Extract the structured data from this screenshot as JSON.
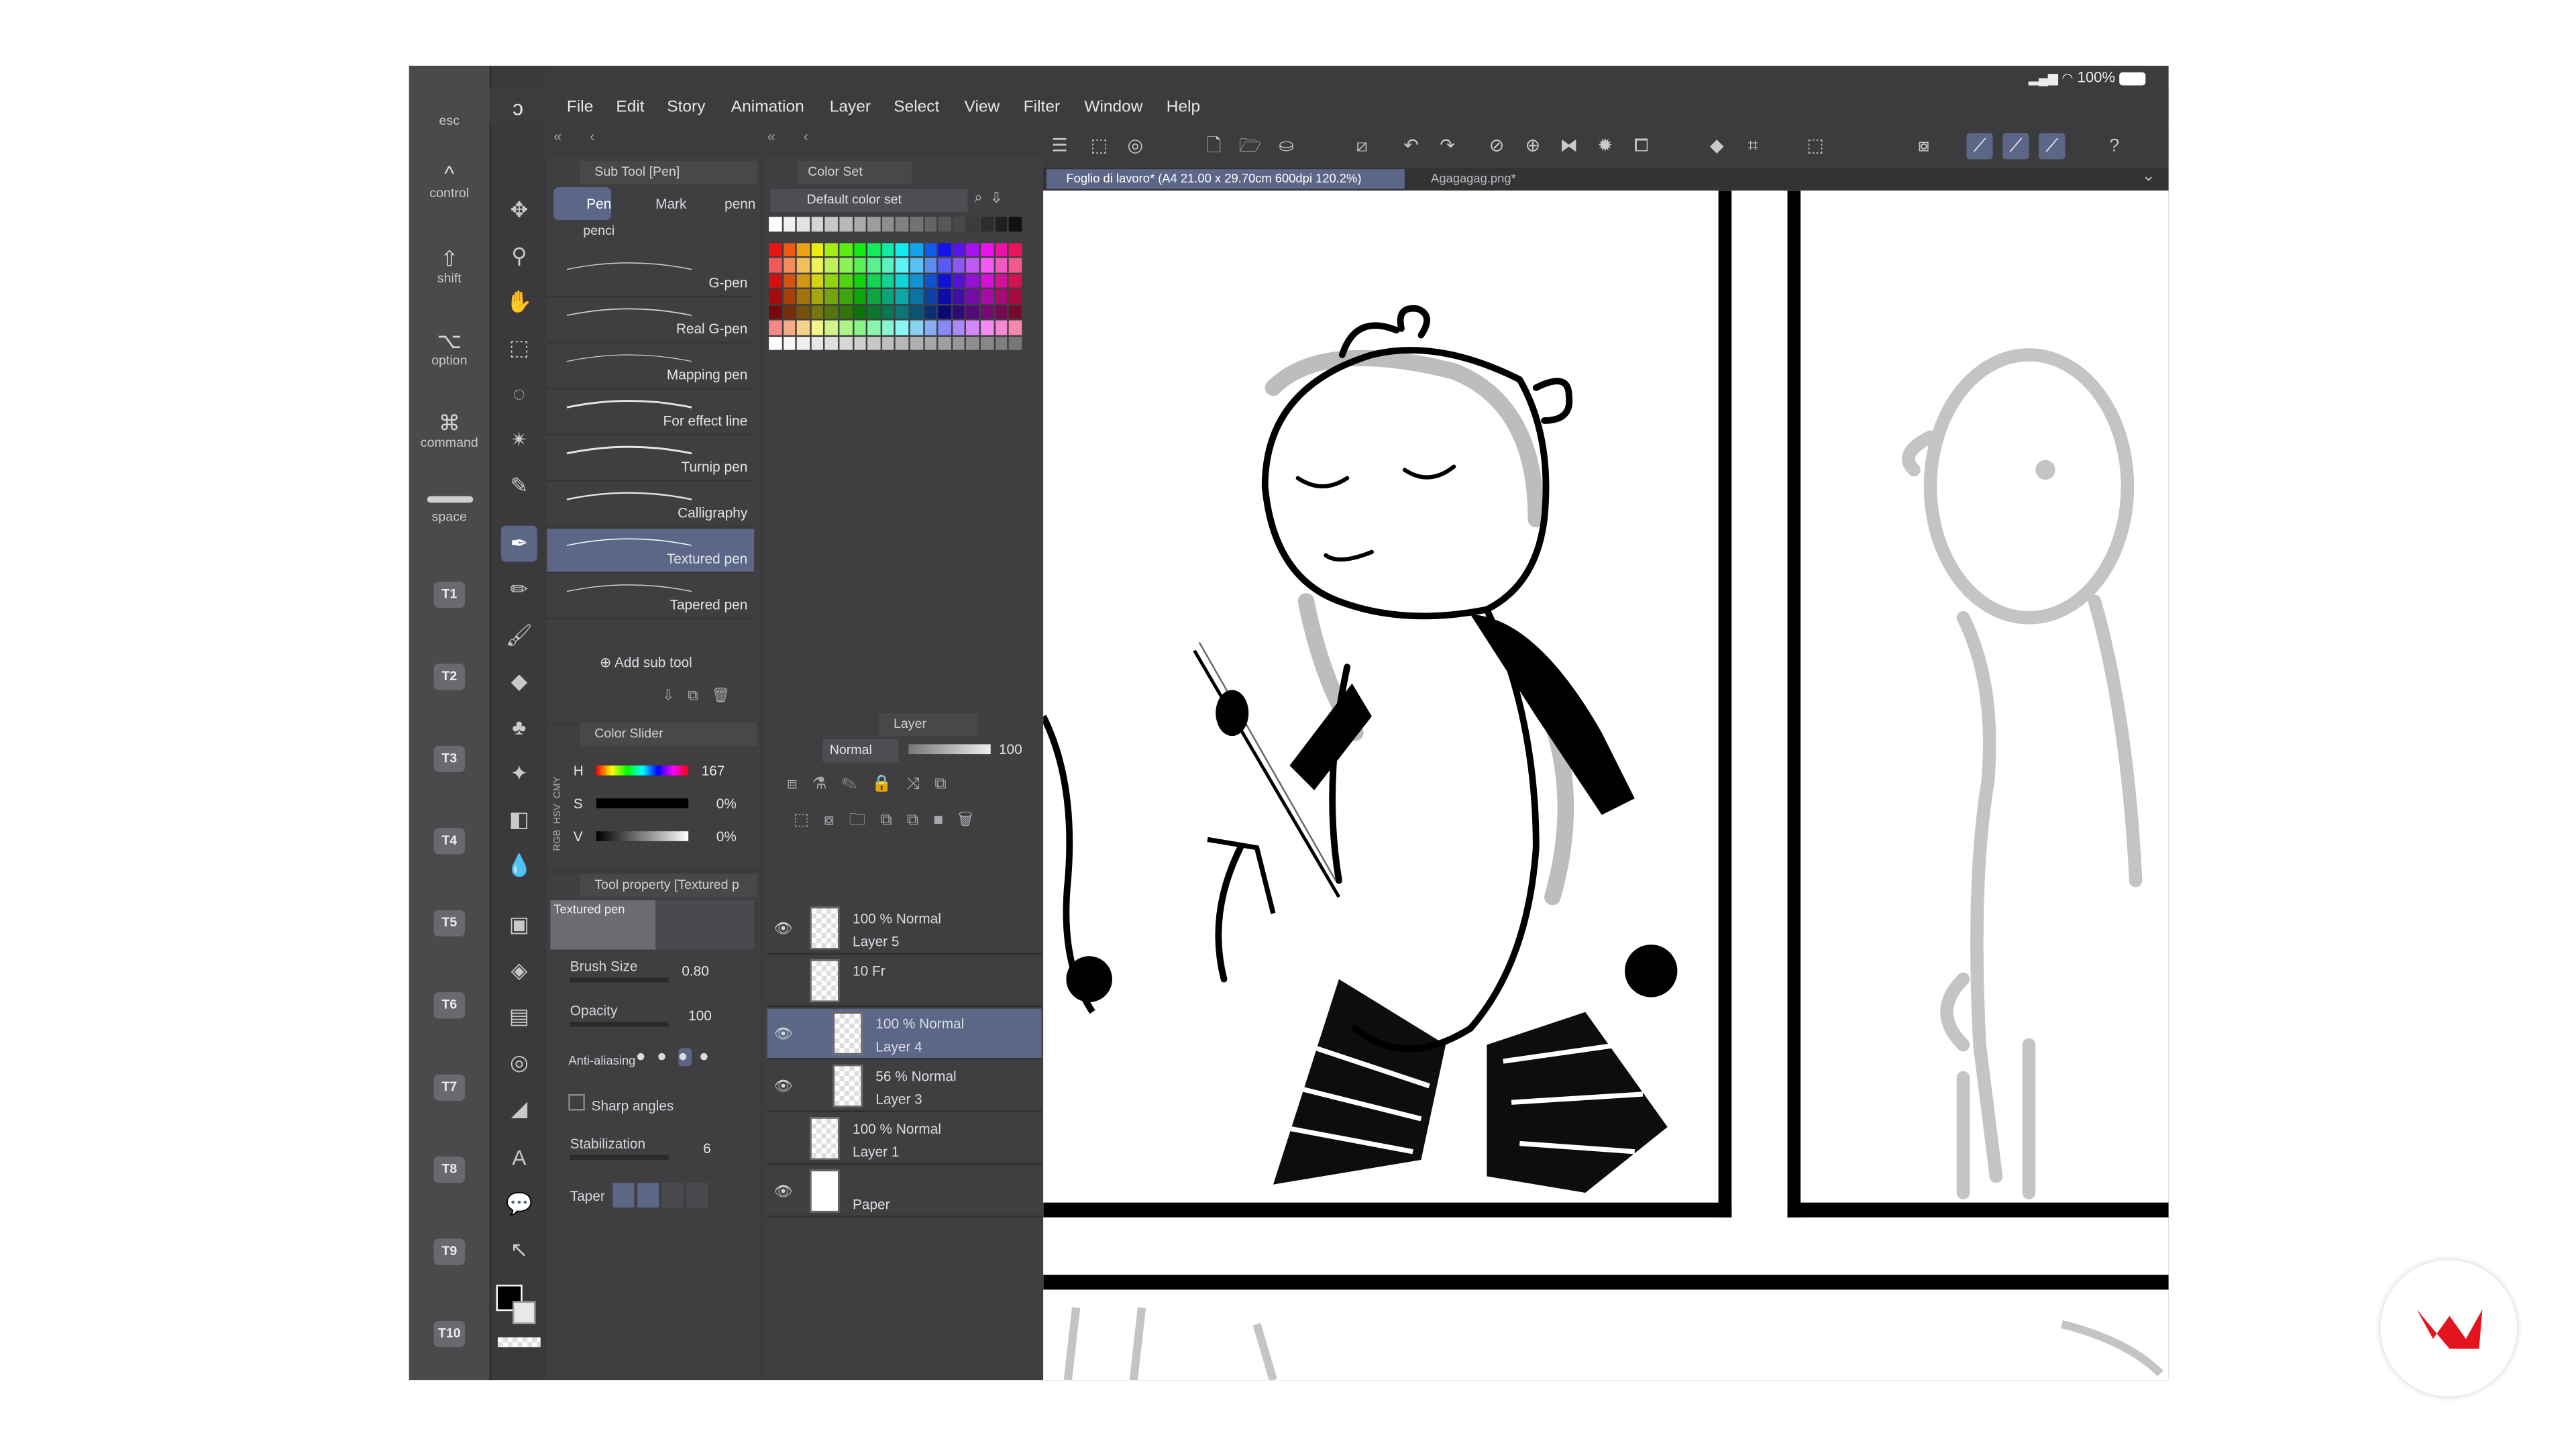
{
  "modifiers": {
    "esc": "esc",
    "control": "control",
    "shift": "shift",
    "option": "option",
    "command": "command",
    "space": "space",
    "control_glyph": "^",
    "shift_glyph": "⇧",
    "option_glyph": "⌥",
    "command_glyph": "⌘"
  },
  "tool_keys": [
    "T1",
    "T2",
    "T3",
    "T4",
    "T5",
    "T6",
    "T7",
    "T8",
    "T9",
    "T10"
  ],
  "menu": {
    "items": [
      "File",
      "Edit",
      "Story",
      "Animation",
      "Layer",
      "Select",
      "View",
      "Filter",
      "Window",
      "Help"
    ]
  },
  "status": {
    "battery": "100%"
  },
  "sub_tool": {
    "title": "Sub Tool [Pen]",
    "tabs": [
      "Pen",
      "Mark",
      "penn"
    ],
    "group": "penci",
    "items": [
      "G-pen",
      "Real G-pen",
      "Mapping pen",
      "For effect line",
      "Turnip pen",
      "Calligraphy",
      "Textured pen",
      "Tapered pen"
    ],
    "selected": "Textured pen",
    "add_label": "Add sub tool"
  },
  "color_set": {
    "title": "Color Set",
    "set_name": "Default color set"
  },
  "color_slider": {
    "title": "Color Slider",
    "h_label": "H",
    "s_label": "S",
    "v_label": "V",
    "h_value": "167",
    "s_value": "0%",
    "v_value": "0%",
    "modes": [
      "RGB",
      "HSV",
      "CMY"
    ]
  },
  "tool_property": {
    "title": "Tool property [Textured p",
    "preview_label": "Textured pen",
    "brush_size_label": "Brush Size",
    "brush_size_value": "0.80",
    "opacity_label": "Opacity",
    "opacity_value": "100",
    "aa_label": "Anti-aliasing",
    "sharp_label": "Sharp angles",
    "stab_label": "Stabilization",
    "stab_value": "6",
    "taper_label": "Taper"
  },
  "layer_panel": {
    "title": "Layer",
    "blend": "Normal",
    "opacity": "100",
    "layers": [
      {
        "pct": "100 %",
        "mode": "Normal",
        "name": "Layer 5"
      },
      {
        "pct": "10",
        "mode": "Fr",
        "name": ""
      },
      {
        "pct": "100 %",
        "mode": "Normal",
        "name": "Layer 4"
      },
      {
        "pct": "56 %",
        "mode": "Normal",
        "name": "Layer 3"
      },
      {
        "pct": "100 %",
        "mode": "Normal",
        "name": "Layer 1"
      },
      {
        "pct": "",
        "mode": "",
        "name": "Paper"
      }
    ]
  },
  "doc_tabs": {
    "active": "Foglio di lavoro* (A4 21.00 x 29.70cm 600dpi 120.2%)",
    "other": "Agagagag.png*"
  },
  "colors": {
    "accent": "#5c6788",
    "panel": "#3f3f42",
    "window": "#3c3c3e",
    "brand": "#e4141e"
  }
}
